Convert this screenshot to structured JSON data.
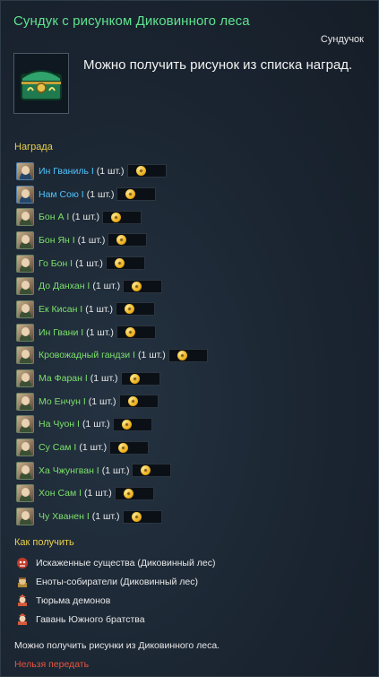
{
  "header": {
    "title": "Сундук с рисунком Диковинного леса",
    "item_type": "Сундучок",
    "description": "Можно получить рисунок из списка наград.",
    "icon": "green-chest-icon"
  },
  "rewards": {
    "label": "Награда",
    "items": [
      {
        "name": "Ин Гваниль I",
        "count": "(1 шт.)",
        "color": "blue"
      },
      {
        "name": "Нам Сою I",
        "count": "(1 шт.)",
        "color": "blue"
      },
      {
        "name": "Бон А I",
        "count": "(1 шт.)",
        "color": "green"
      },
      {
        "name": "Бон Ян I",
        "count": "(1 шт.)",
        "color": "green"
      },
      {
        "name": "Го Бон I",
        "count": "(1 шт.)",
        "color": "green"
      },
      {
        "name": "До Данхан I",
        "count": "(1 шт.)",
        "color": "green"
      },
      {
        "name": "Ек Кисан I",
        "count": "(1 шт.)",
        "color": "green"
      },
      {
        "name": "Ин Гвани I",
        "count": "(1 шт.)",
        "color": "green"
      },
      {
        "name": "Кровожадный гандзи I",
        "count": "(1 шт.)",
        "color": "green"
      },
      {
        "name": "Ма Фаран I",
        "count": "(1 шт.)",
        "color": "green"
      },
      {
        "name": "Мо Енчун I",
        "count": "(1 шт.)",
        "color": "green"
      },
      {
        "name": "На Чуон I",
        "count": "(1 шт.)",
        "color": "green"
      },
      {
        "name": "Су Сам I",
        "count": "(1 шт.)",
        "color": "green"
      },
      {
        "name": "Ха Чжунгван I",
        "count": "(1 шт.)",
        "color": "green"
      },
      {
        "name": "Хон Сам I",
        "count": "(1 шт.)",
        "color": "green"
      },
      {
        "name": "Чу Хванен I",
        "count": "(1 шт.)",
        "color": "green"
      }
    ]
  },
  "obtain": {
    "label": "Как получить",
    "sources": [
      {
        "text": "Искаженные существа (Диковинный лес)",
        "icon": "red-monster-icon"
      },
      {
        "text": "Еноты-собиратели (Диковинный лес)",
        "icon": "raccoon-npc-icon"
      },
      {
        "text": "Тюрьма демонов",
        "icon": "dungeon-icon"
      },
      {
        "text": "Гавань Южного братства",
        "icon": "dungeon-icon"
      }
    ]
  },
  "footer": {
    "note": "Можно получить рисунки из Диковинного леса.",
    "warning": "Нельзя передать"
  },
  "colors": {
    "title": "#5fe38f",
    "section": "#e9d04a",
    "reward_blue": "#4fc3ff",
    "reward_green": "#7ce06a",
    "warning": "#e9553f"
  }
}
